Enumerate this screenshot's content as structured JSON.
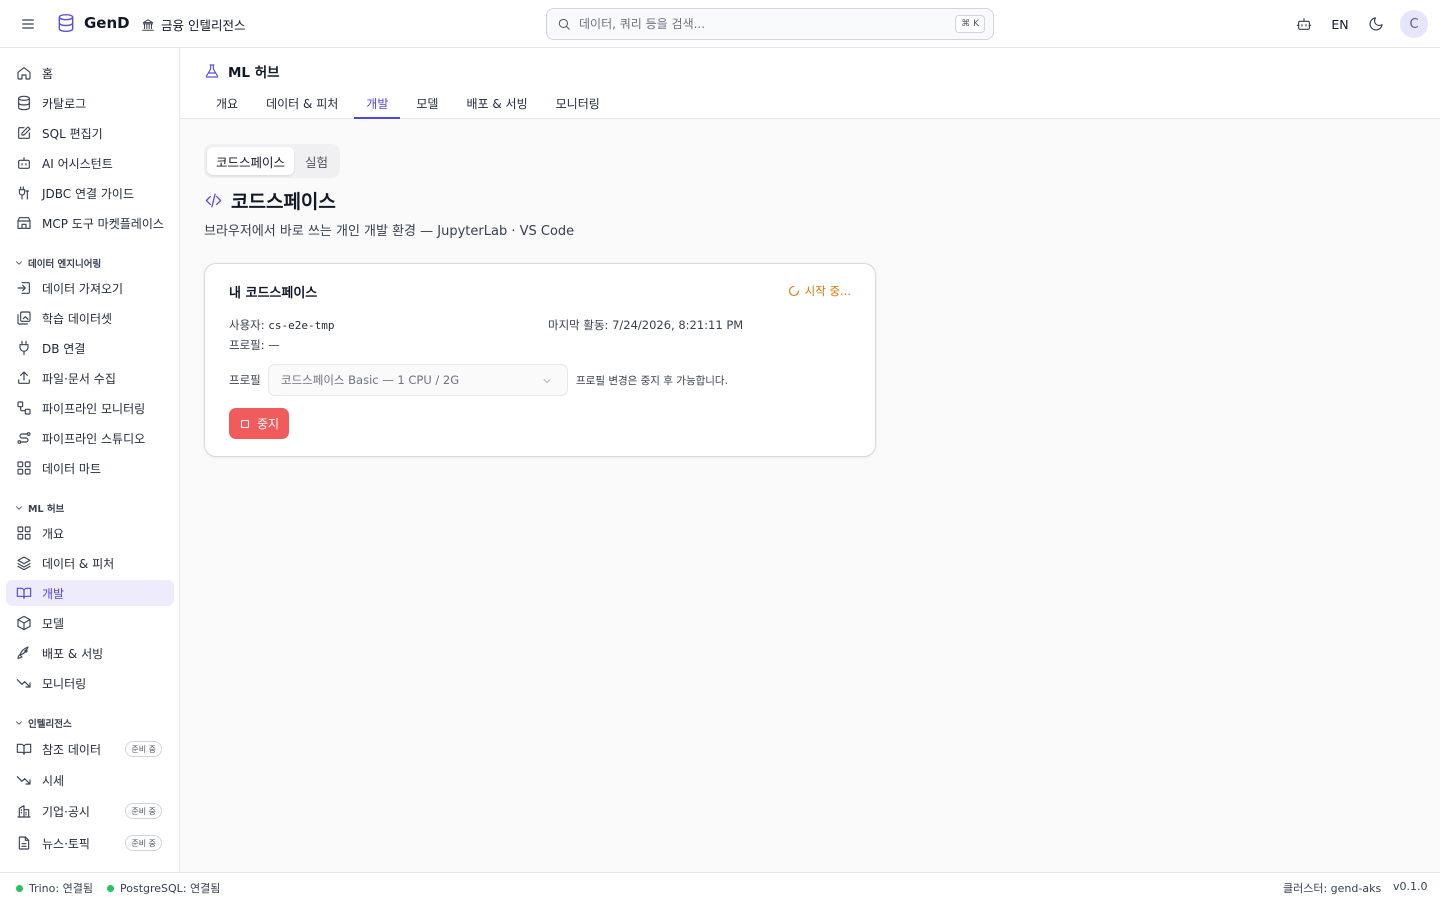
{
  "topbar": {
    "brand": "GenD",
    "workspace": "금융 인텔리전스",
    "search_placeholder": "데이터, 쿼리 등을 검색...",
    "shortcut": "⌘ K",
    "lang": "EN",
    "avatar_initial": "C"
  },
  "sidebar": {
    "main_items": [
      "홈",
      "카탈로그",
      "SQL 편집기",
      "AI 어시스턴트",
      "JDBC 연결 가이드",
      "MCP 도구 마켓플레이스"
    ],
    "section_data_eng": "데이터 엔지니어링",
    "data_eng_items": [
      "데이터 가져오기",
      "학습 데이터셋",
      "DB 연결",
      "파일·문서 수집",
      "파이프라인 모니터링",
      "파이프라인 스튜디오",
      "데이터 마트"
    ],
    "section_ml": "ML 허브",
    "ml_items": [
      "개요",
      "데이터 & 피처",
      "개발",
      "모델",
      "배포 & 서빙",
      "모니터링"
    ],
    "section_intel": "인텔리전스",
    "intel_items": [
      "참조 데이터",
      "시세",
      "기업·공시",
      "뉴스·토픽"
    ],
    "badge": "준비 중"
  },
  "main": {
    "page_title": "ML 허브",
    "tabs": [
      "개요",
      "데이터 & 피처",
      "개발",
      "모델",
      "배포 & 서빙",
      "모니터링"
    ],
    "segments": [
      "코드스페이스",
      "실험"
    ],
    "heading": "코드스페이스",
    "subtitle": "브라우저에서 바로 쓰는 개인 개발 환경 — JupyterLab · VS Code",
    "card": {
      "title": "내 코드스페이스",
      "status": "시작 중...",
      "user_label": "사용자:",
      "user_value": "cs-e2e-tmp",
      "last_activity": "마지막 활동: 7/24/2026, 8:21:11 PM",
      "profile_line": "프로필: —",
      "profile_label": "프로필",
      "profile_selected": "코드스페이스 Basic — 1 CPU / 2G",
      "profile_note": "프로필 변경은 중지 후 가능합니다.",
      "stop_label": "중지"
    }
  },
  "footer": {
    "trino": "Trino: 연결됨",
    "postgres": "PostgreSQL: 연결됨",
    "cluster": "클러스터: gend-aks",
    "version": "v0.1.0"
  },
  "colors": {
    "accent": "#4f46e5",
    "danger": "#f15b5b",
    "warning": "#d97706",
    "ok": "#22c55e"
  }
}
